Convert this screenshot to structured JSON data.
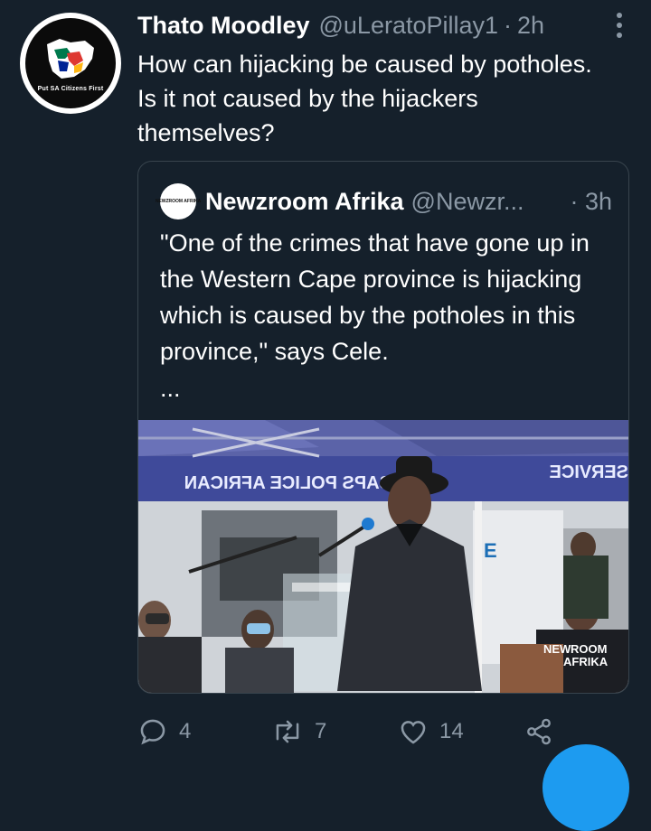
{
  "tweet": {
    "author_name": "Thato Moodley",
    "author_handle": "@uLeratoPillay1",
    "separator": "·",
    "time": "2h",
    "avatar_caption": "Put SA Citizens First",
    "text": "How can hijacking be caused by potholes. Is it not caused by the hijackers themselves?"
  },
  "quoted": {
    "author_name": "Newzroom Afrika",
    "author_handle": "@Newzr...",
    "separator": "·",
    "time": "3h",
    "avatar_text": "NEWZROOM AFRIKA",
    "text": "\"One of the crimes that have gone up in the Western Cape province is hijacking which is caused by the potholes in this province,\" says Cele.",
    "ellipsis": "...",
    "media": {
      "banner_text_left": "SAPS POLICE AFRICAN",
      "banner_text_right": "SERVICE",
      "watermark_line1": "NEW",
      "watermark_line2": "ROOM",
      "watermark_line3": "AFRIKA"
    }
  },
  "actions": {
    "reply_count": "4",
    "retweet_count": "7",
    "like_count": "14"
  },
  "colors": {
    "background": "#15202b",
    "secondary_text": "#8b98a5",
    "accent": "#1d9bf0",
    "border": "#38444d"
  },
  "icons": [
    "more-icon",
    "reply-icon",
    "retweet-icon",
    "like-icon",
    "share-icon"
  ]
}
